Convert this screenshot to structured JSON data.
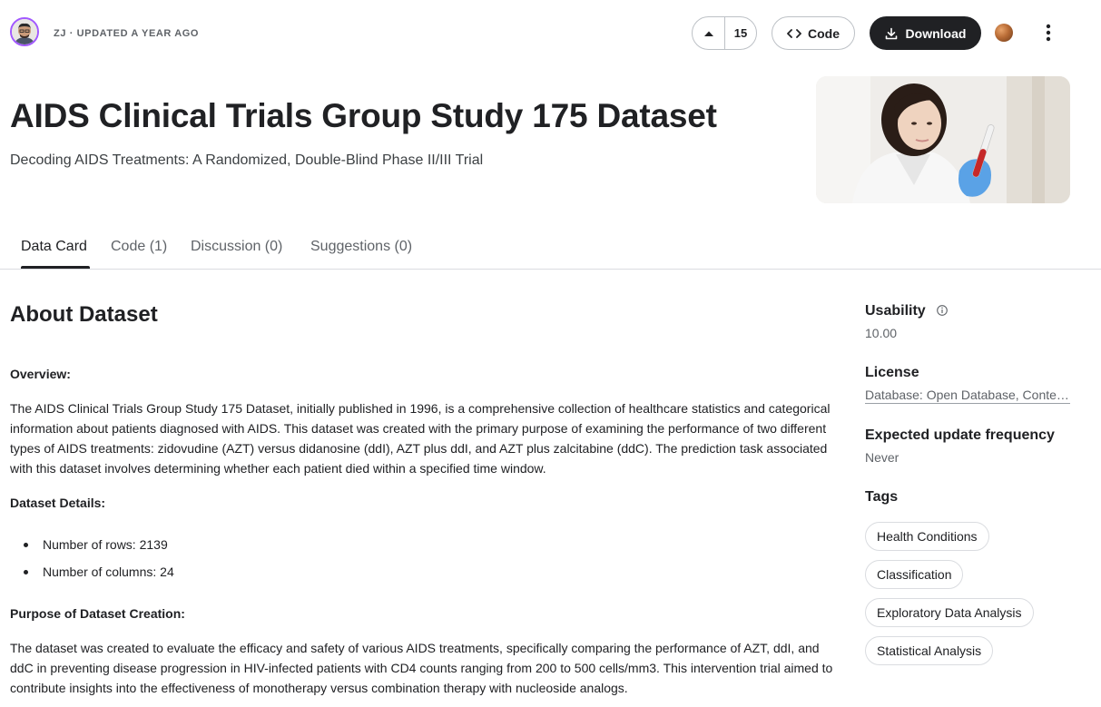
{
  "owner": {
    "meta": "ZJ · UPDATED A YEAR AGO"
  },
  "actions": {
    "vote_count": "15",
    "code_label": "Code",
    "download_label": "Download"
  },
  "header": {
    "title": "AIDS Clinical Trials Group Study 175 Dataset",
    "subtitle": "Decoding AIDS Treatments: A Randomized, Double-Blind Phase II/III Trial"
  },
  "tabs": [
    {
      "label": "Data Card"
    },
    {
      "label": "Code (1)"
    },
    {
      "label": "Discussion (0)"
    },
    {
      "label": "Suggestions (0)"
    }
  ],
  "about": {
    "title": "About Dataset",
    "overview_heading": "Overview:",
    "overview_text": "The AIDS Clinical Trials Group Study 175 Dataset, initially published in 1996, is a comprehensive collection of healthcare statistics and categorical information about patients diagnosed with AIDS. This dataset was created with the primary purpose of examining the performance of two different types of AIDS treatments: zidovudine (AZT) versus didanosine (ddI), AZT plus ddI, and AZT plus zalcitabine (ddC). The prediction task associated with this dataset involves determining whether each patient died within a specified time window.",
    "details_heading": "Dataset Details:",
    "details": [
      "Number of rows: 2139",
      "Number of columns: 24"
    ],
    "purpose_heading": "Purpose of Dataset Creation:",
    "purpose_text": "The dataset was created to evaluate the efficacy and safety of various AIDS treatments, specifically comparing the performance of AZT, ddI, and ddC in preventing disease progression in HIV-infected patients with CD4 counts ranging from 200 to 500 cells/mm3. This intervention trial aimed to contribute insights into the effectiveness of monotherapy versus combination therapy with nucleoside analogs."
  },
  "sidebar": {
    "usability_label": "Usability",
    "usability_value": "10.00",
    "license_label": "License",
    "license_value": "Database: Open Database, Contents: Database Contents",
    "update_label": "Expected update frequency",
    "update_value": "Never",
    "tags_label": "Tags",
    "tags": [
      {
        "label": "Health Conditions"
      },
      {
        "label": "Classification"
      },
      {
        "label": "Exploratory Data Analysis"
      },
      {
        "label": "Statistical Analysis"
      }
    ]
  },
  "colors": {
    "primary_dark": "#202124",
    "avatar_ring": "#a259ff",
    "border": "#dadce0"
  },
  "icons": {
    "upvote": "caret-up-icon",
    "code": "code-brackets-icon",
    "download": "download-icon",
    "more": "more-vertical-icon",
    "info": "info-icon"
  }
}
